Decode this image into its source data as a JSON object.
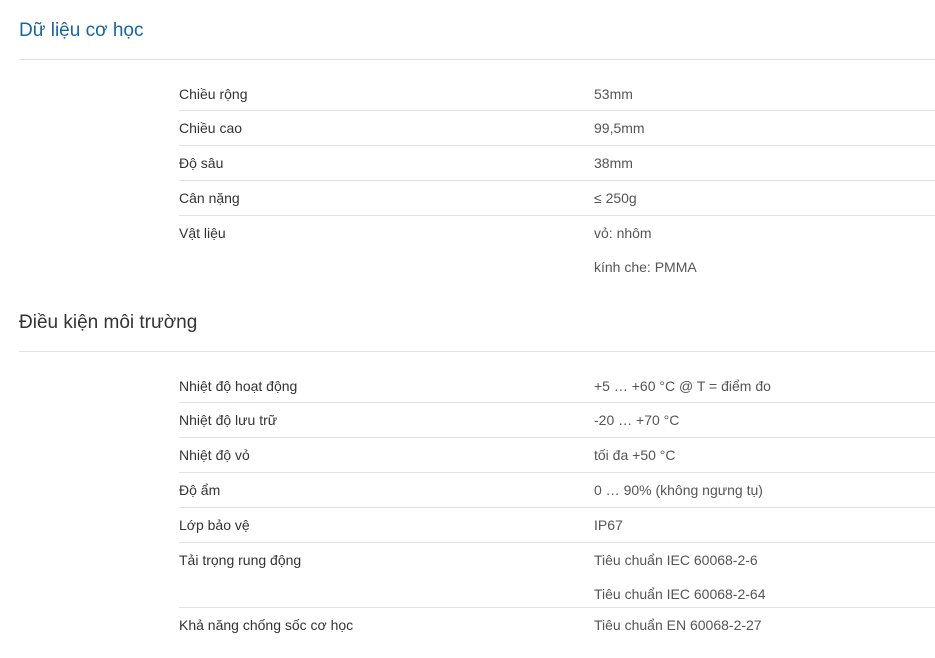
{
  "sections": [
    {
      "title": "Dữ liệu cơ học",
      "rows": [
        {
          "label": "Chiều rộng",
          "values": [
            "53mm"
          ]
        },
        {
          "label": "Chiều cao",
          "values": [
            "99,5mm"
          ]
        },
        {
          "label": "Độ sâu",
          "values": [
            "38mm"
          ]
        },
        {
          "label": "Cân nặng",
          "values": [
            "≤ 250g"
          ]
        },
        {
          "label": "Vật liệu",
          "values": [
            "vỏ: nhôm",
            "kính che: PMMA"
          ]
        }
      ]
    },
    {
      "title": "Điều kiện môi trường",
      "rows": [
        {
          "label": "Nhiệt độ hoạt động",
          "values": [
            "+5 … +60 °C @ T = điểm đo"
          ]
        },
        {
          "label": "Nhiệt độ lưu trữ",
          "values": [
            "-20 … +70 °C"
          ]
        },
        {
          "label": "Nhiệt độ vỏ",
          "values": [
            "tối đa +50 °C"
          ]
        },
        {
          "label": "Độ ẩm",
          "values": [
            "0 … 90% (không ngưng tụ)"
          ]
        },
        {
          "label": "Lớp bảo vệ",
          "values": [
            "IP67"
          ]
        },
        {
          "label": "Tải trọng rung động",
          "values": [
            "Tiêu chuẩn IEC 60068-2-6",
            "Tiêu chuẩn IEC 60068-2-64"
          ]
        },
        {
          "label": "Khả năng chống sốc cơ học",
          "values": [
            "Tiêu chuẩn EN 60068-2-27"
          ]
        }
      ]
    }
  ]
}
